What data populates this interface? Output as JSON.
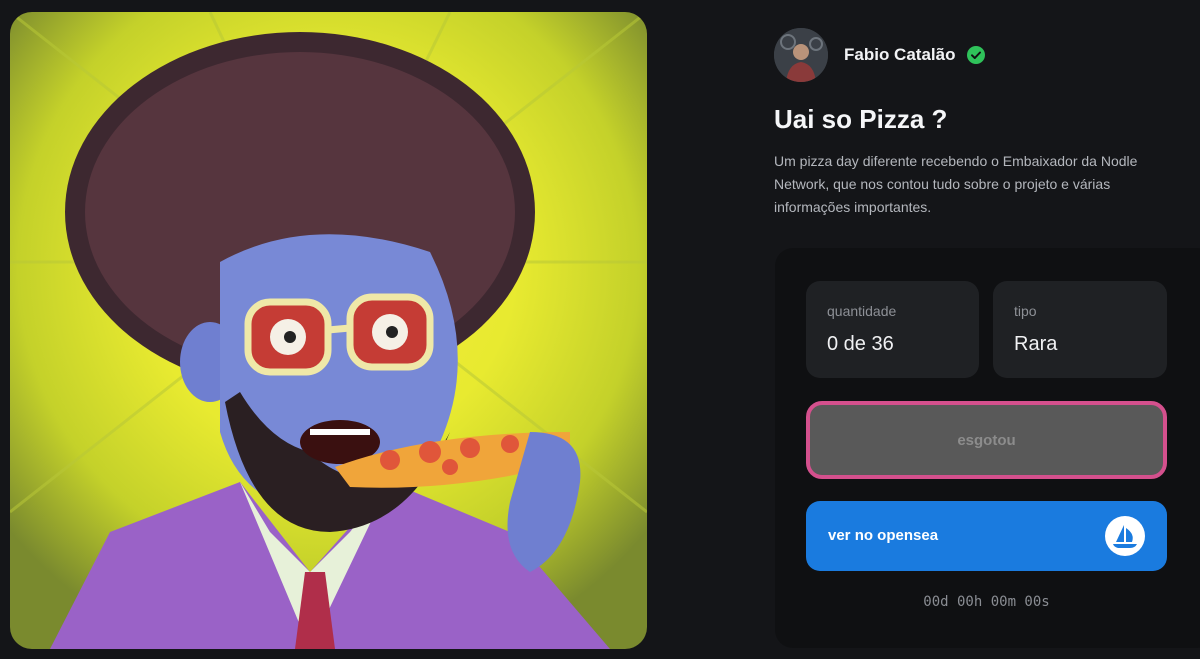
{
  "creator": {
    "name": "Fabio Catalão",
    "verified": true
  },
  "nft": {
    "title": "Uai so Pizza ?",
    "description": "Um pizza day diferente recebendo o Embaixador da Nodle Network, que nos contou tudo sobre o projeto e várias informações importantes.",
    "quantity_label": "quantidade",
    "quantity_value": "0 de 36",
    "type_label": "tipo",
    "type_value": "Rara"
  },
  "actions": {
    "sold_out_label": "esgotou",
    "opensea_label": "ver no opensea"
  },
  "countdown": "00d 00h 00m 00s",
  "colors": {
    "background": "#141518",
    "card": "#1f2124",
    "soldout_border": "#d4508d",
    "opensea_blue": "#1a7bdf",
    "verified_green": "#2fc25a"
  },
  "icons": [
    "verified-check-icon",
    "opensea-logo-icon"
  ]
}
